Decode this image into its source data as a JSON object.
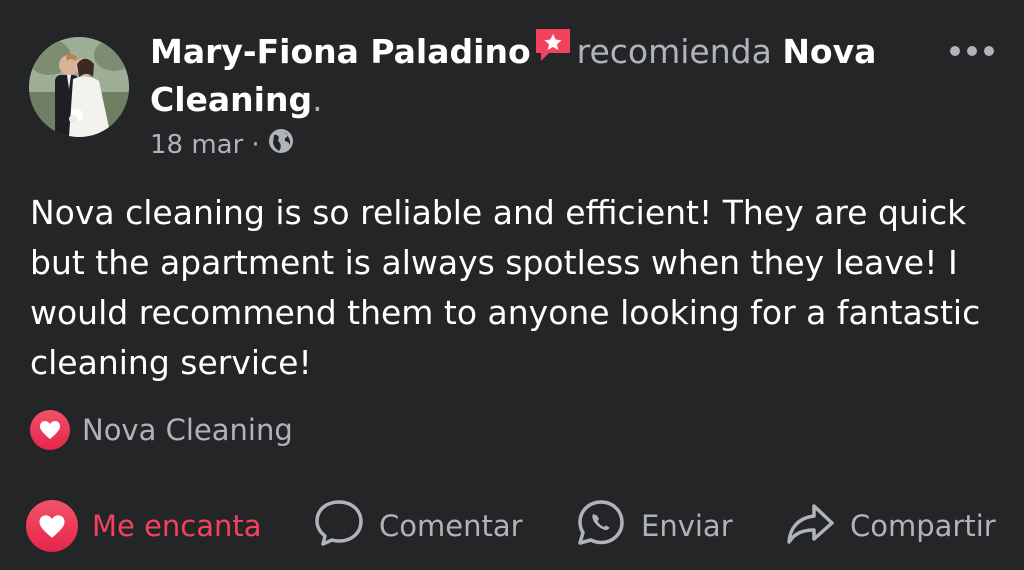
{
  "post": {
    "author": "Mary-Fiona Paladino",
    "recommends_text": "recomienda",
    "page_name_line1": "Nova",
    "page_name_line2": "Cleaning",
    "period": ".",
    "date": "18 mar",
    "separator": "·",
    "privacy_icon": "globe-icon",
    "more_icon": "more-options-icon",
    "body": "Nova cleaning is so reliable and efficient! They are quick but the apartment is always spotless when they leave! I would recommend them to anyone looking for a fantastic cleaning service!",
    "tag_label": "Nova Cleaning"
  },
  "actions": {
    "love_label": "Me encanta",
    "comment_label": "Comentar",
    "send_label": "Enviar",
    "share_label": "Compartir"
  },
  "colors": {
    "background": "#242526",
    "text_primary": "#ffffff",
    "text_secondary": "#b0b3b8",
    "love_red": "#f3425f"
  }
}
